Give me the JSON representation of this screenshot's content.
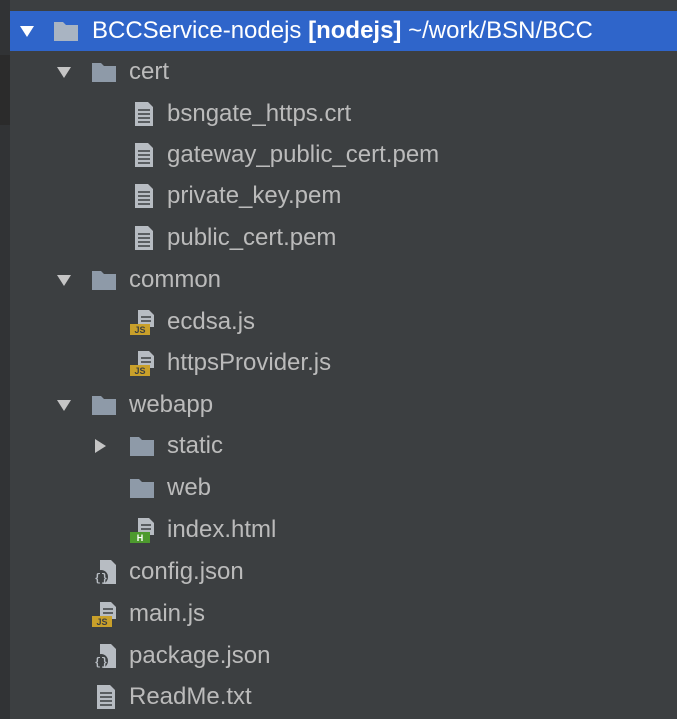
{
  "root": {
    "name": "BCCService-nodejs",
    "module": "[nodejs]",
    "path": "~/work/BSN/BCC"
  },
  "tree": {
    "cert": {
      "name": "cert",
      "files": [
        "bsngate_https.crt",
        "gateway_public_cert.pem",
        "private_key.pem",
        "public_cert.pem"
      ]
    },
    "common": {
      "name": "common",
      "files": [
        "ecdsa.js",
        "httpsProvider.js"
      ]
    },
    "webapp": {
      "name": "webapp",
      "static": "static",
      "web": "web",
      "index": "index.html"
    },
    "config": "config.json",
    "main": "main.js",
    "package": "package.json",
    "readme": "ReadMe.txt"
  },
  "icon_badges": {
    "js": "JS",
    "html": "H"
  },
  "colors": {
    "background": "#3c3f41",
    "selection": "#2f65ca",
    "text": "#bbbbbb",
    "folder": "#8e9aa8",
    "file": "#b7bcc2",
    "js_badge": "#c9a02a",
    "html_badge": "#4d9a2e"
  }
}
